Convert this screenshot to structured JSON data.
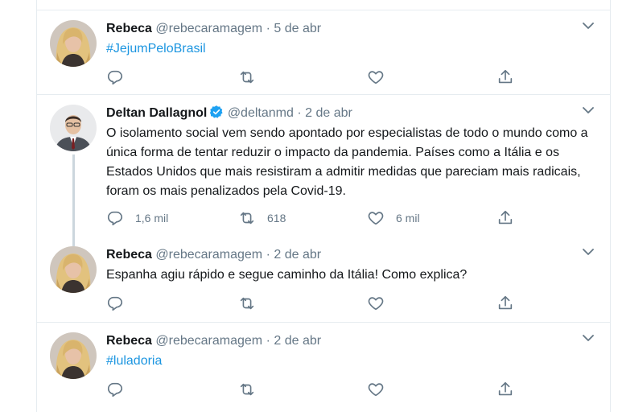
{
  "tweets": [
    {
      "name": "Rebeca",
      "handle": "@rebecaramagem",
      "sep": "·",
      "date": "5 de abr",
      "text": "#JejumPeloBrasil",
      "is_hashtag": true,
      "replies": "",
      "retweets": "",
      "likes": ""
    },
    {
      "name": "Deltan Dallagnol",
      "handle": "@deltanmd",
      "sep": "·",
      "date": "2 de abr",
      "text": "O isolamento social vem sendo apontado por especialistas de todo o mundo como a única forma de tentar reduzir o impacto da pandemia. Países como a Itália e os Estados Unidos que mais resistiram a admitir medidas que pareciam mais radicais, foram os mais penalizados pela Covid-19.",
      "verified": true,
      "replies": "1,6 mil",
      "retweets": "618",
      "likes": "6 mil"
    },
    {
      "name": "Rebeca",
      "handle": "@rebecaramagem",
      "sep": "·",
      "date": "2 de abr",
      "text": "Espanha agiu rápido e segue caminho da Itália! Como explica?",
      "replies": "",
      "retweets": "",
      "likes": ""
    },
    {
      "name": "Rebeca",
      "handle": "@rebecaramagem",
      "sep": "·",
      "date": "2 de abr",
      "text": "#luladoria",
      "is_hashtag": true,
      "replies": "",
      "retweets": "",
      "likes": ""
    }
  ],
  "colors": {
    "hashtag": "#1b95e0",
    "verified": "#1da1f2",
    "muted": "#657786",
    "divider": "#e6ecf0"
  },
  "icons": [
    "reply-icon",
    "retweet-icon",
    "like-icon",
    "share-icon",
    "chevron-down-icon",
    "verified-icon"
  ]
}
